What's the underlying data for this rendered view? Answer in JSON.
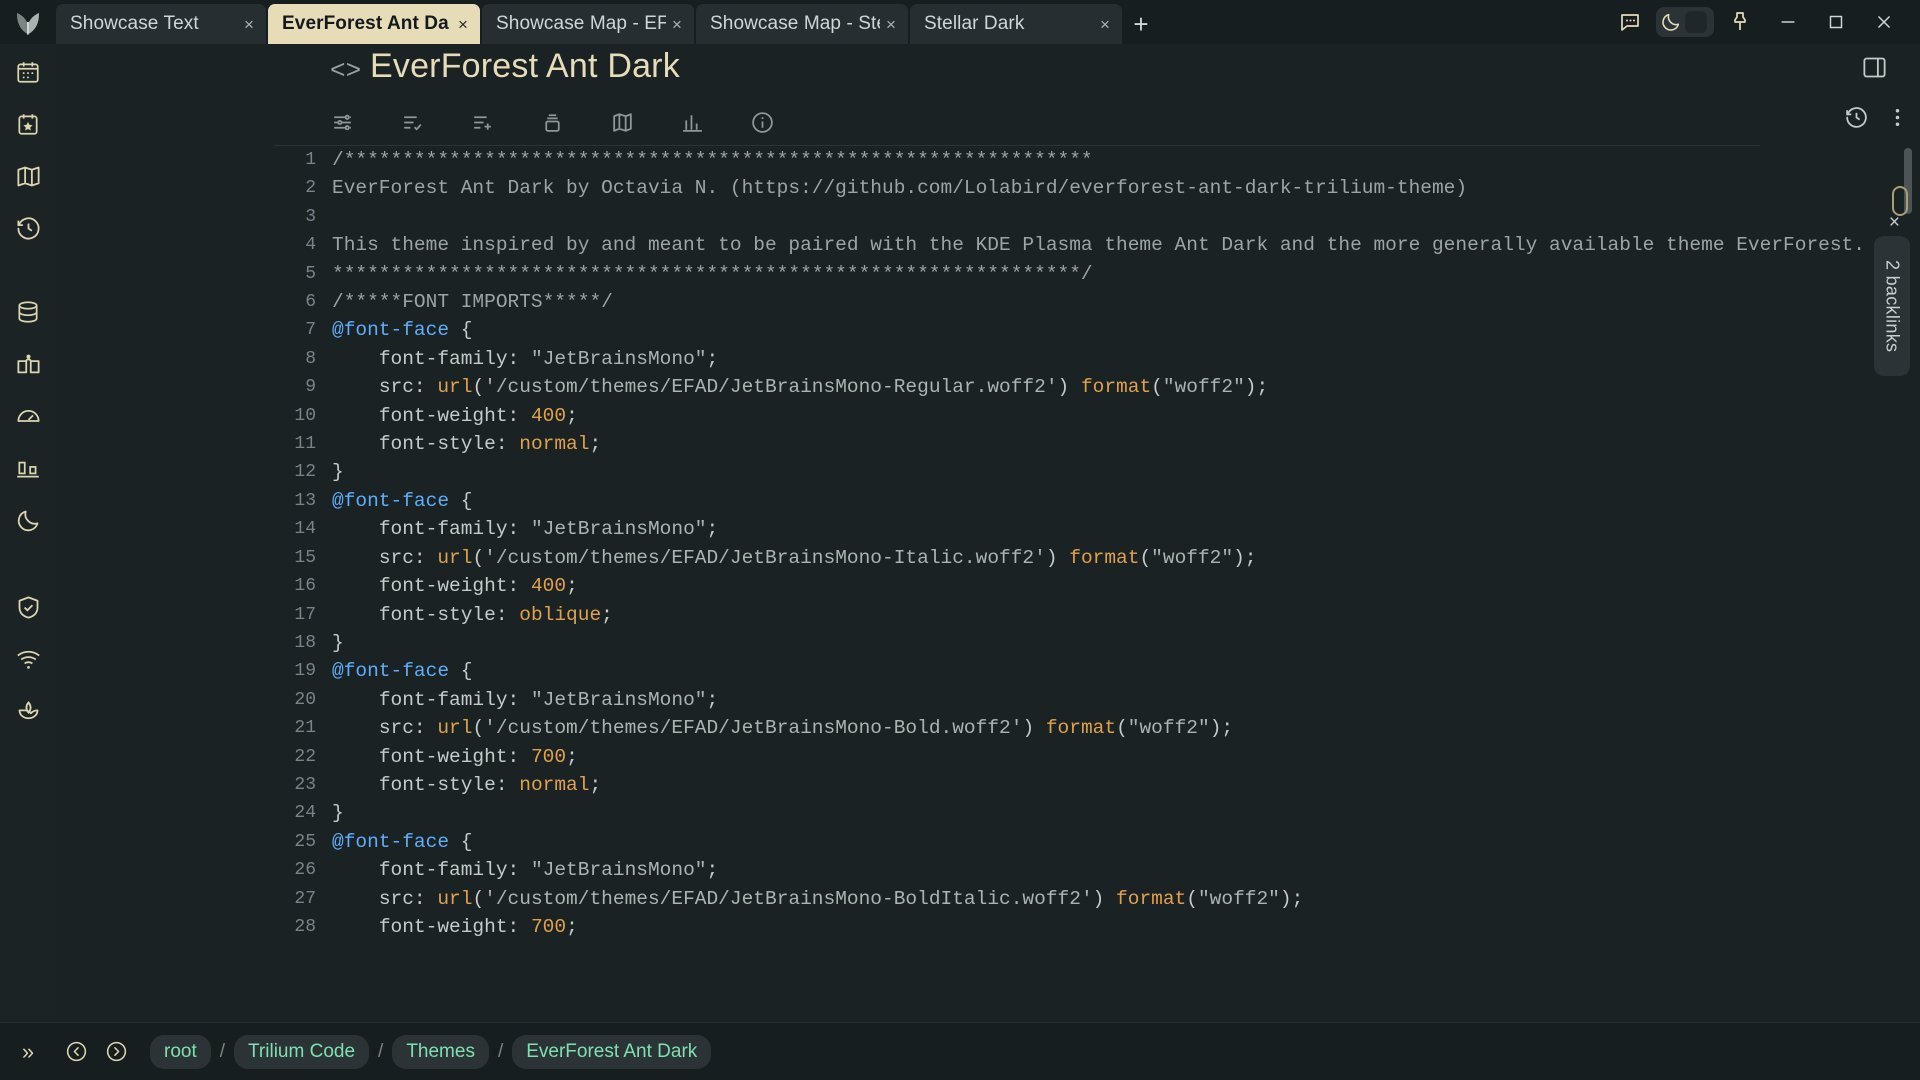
{
  "window": {
    "tabs": [
      {
        "title": "Showcase Text",
        "active": false
      },
      {
        "title": "EverForest Ant Da",
        "active": true
      },
      {
        "title": "Showcase Map - EF/",
        "active": false
      },
      {
        "title": "Showcase Map - Ste",
        "active": false
      },
      {
        "title": "Stellar Dark",
        "active": false
      }
    ],
    "new_tab_label": "+",
    "close_label": "×",
    "controls": {
      "chat_icon": "chat-bubble-icon",
      "theme_toggle_icon": "moon-icon",
      "pin_icon": "pin-icon",
      "minimize_label": "—",
      "maximize_label": "□",
      "close_label": "×"
    }
  },
  "sidebar": {
    "logo_icon": "trilium-leaf-logo",
    "items": [
      {
        "icon": "calendar-icon",
        "name": "sidebar-item-calendar"
      },
      {
        "icon": "calendar-star-icon",
        "name": "sidebar-item-favorites"
      },
      {
        "icon": "map-icon",
        "name": "sidebar-item-map"
      },
      {
        "icon": "history-clock-icon",
        "name": "sidebar-item-recent"
      },
      {
        "icon": "database-icon",
        "name": "sidebar-item-database"
      },
      {
        "icon": "open-book-icon",
        "name": "sidebar-item-notes"
      },
      {
        "icon": "gauge-icon",
        "name": "sidebar-item-dashboard"
      },
      {
        "icon": "bar-chart-icon",
        "name": "sidebar-item-stats"
      },
      {
        "icon": "moon-icon",
        "name": "sidebar-item-theme"
      },
      {
        "icon": "shield-check-icon",
        "name": "sidebar-item-security"
      },
      {
        "icon": "wifi-icon",
        "name": "sidebar-item-sync"
      },
      {
        "icon": "lotus-icon",
        "name": "sidebar-item-zen"
      }
    ],
    "expand_label": "»"
  },
  "note": {
    "type_icon": "code-brackets-icon",
    "title": "EverForest Ant Dark",
    "panel_toggle_icon": "right-panel-icon",
    "toolbar": [
      {
        "icon": "sliders-icon",
        "name": "tool-attributes"
      },
      {
        "icon": "list-check-icon",
        "name": "tool-tasks"
      },
      {
        "icon": "list-plus-icon",
        "name": "tool-add-list"
      },
      {
        "icon": "archive-box-icon",
        "name": "tool-archive"
      },
      {
        "icon": "book-map-icon",
        "name": "tool-book"
      },
      {
        "icon": "bar-chart-icon",
        "name": "tool-chart"
      },
      {
        "icon": "info-circle-icon",
        "name": "tool-info"
      }
    ],
    "toolbar_right": [
      {
        "icon": "history-revision-icon",
        "name": "tool-revisions"
      },
      {
        "icon": "more-vertical-icon",
        "name": "tool-more"
      }
    ]
  },
  "backlinks": {
    "label": "2 backlinks",
    "close_label": "×"
  },
  "breadcrumb": {
    "back_icon": "arrow-back-circle-icon",
    "forward_icon": "arrow-forward-circle-icon",
    "separator": "/",
    "items": [
      "root",
      "Trilium Code",
      "Themes",
      "EverForest Ant Dark"
    ]
  },
  "colors": {
    "accent": "#e6dcb8",
    "background": "#1b2224",
    "tabbar": "#171e20",
    "breadcrumb_text": "#7fe0b0",
    "comment": "#9aa6a3",
    "at_rule": "#5eaefb",
    "function": "#e0a14a",
    "string": "#a8b5b1"
  },
  "code": {
    "lines": [
      {
        "n": 1,
        "tokens": [
          {
            "t": "/****************************************************************",
            "c": "cmt"
          }
        ]
      },
      {
        "n": 2,
        "tokens": [
          {
            "t": "EverForest Ant Dark by Octavia N. (https://github.com/Lolabird/everforest-ant-dark-trilium-theme)",
            "c": "cmt"
          }
        ]
      },
      {
        "n": 3,
        "tokens": []
      },
      {
        "n": 4,
        "tokens": [
          {
            "t": "This theme inspired by and meant to be paired with the KDE Plasma theme Ant Dark and the more generally available theme EverForest.",
            "c": "cmt"
          }
        ]
      },
      {
        "n": 5,
        "tokens": [
          {
            "t": "****************************************************************/",
            "c": "cmt"
          }
        ]
      },
      {
        "n": 6,
        "tokens": [
          {
            "t": "/*****FONT IMPORTS*****/",
            "c": "cmt"
          }
        ]
      },
      {
        "n": 7,
        "tokens": [
          {
            "t": "@font-face",
            "c": "atr"
          },
          {
            "t": " {",
            "c": "punc"
          }
        ]
      },
      {
        "n": 8,
        "tokens": [
          {
            "t": "    font-family",
            "c": "prop"
          },
          {
            "t": ": ",
            "c": "punc"
          },
          {
            "t": "\"JetBrainsMono\"",
            "c": "str"
          },
          {
            "t": ";",
            "c": "punc"
          }
        ]
      },
      {
        "n": 9,
        "tokens": [
          {
            "t": "    src",
            "c": "prop"
          },
          {
            "t": ": ",
            "c": "punc"
          },
          {
            "t": "url",
            "c": "fn"
          },
          {
            "t": "(",
            "c": "punc"
          },
          {
            "t": "'/custom/themes/EFAD/JetBrainsMono-Regular.woff2'",
            "c": "str"
          },
          {
            "t": ") ",
            "c": "punc"
          },
          {
            "t": "format",
            "c": "fn"
          },
          {
            "t": "(",
            "c": "punc"
          },
          {
            "t": "\"woff2\"",
            "c": "str"
          },
          {
            "t": ");",
            "c": "punc"
          }
        ]
      },
      {
        "n": 10,
        "tokens": [
          {
            "t": "    font-weight",
            "c": "prop"
          },
          {
            "t": ": ",
            "c": "punc"
          },
          {
            "t": "400",
            "c": "num2"
          },
          {
            "t": ";",
            "c": "punc"
          }
        ]
      },
      {
        "n": 11,
        "tokens": [
          {
            "t": "    font-style",
            "c": "prop"
          },
          {
            "t": ": ",
            "c": "punc"
          },
          {
            "t": "normal",
            "c": "num2"
          },
          {
            "t": ";",
            "c": "punc"
          }
        ]
      },
      {
        "n": 12,
        "tokens": [
          {
            "t": "}",
            "c": "punc"
          }
        ]
      },
      {
        "n": 13,
        "tokens": [
          {
            "t": "@font-face",
            "c": "atr"
          },
          {
            "t": " {",
            "c": "punc"
          }
        ]
      },
      {
        "n": 14,
        "tokens": [
          {
            "t": "    font-family",
            "c": "prop"
          },
          {
            "t": ": ",
            "c": "punc"
          },
          {
            "t": "\"JetBrainsMono\"",
            "c": "str"
          },
          {
            "t": ";",
            "c": "punc"
          }
        ]
      },
      {
        "n": 15,
        "tokens": [
          {
            "t": "    src",
            "c": "prop"
          },
          {
            "t": ": ",
            "c": "punc"
          },
          {
            "t": "url",
            "c": "fn"
          },
          {
            "t": "(",
            "c": "punc"
          },
          {
            "t": "'/custom/themes/EFAD/JetBrainsMono-Italic.woff2'",
            "c": "str"
          },
          {
            "t": ") ",
            "c": "punc"
          },
          {
            "t": "format",
            "c": "fn"
          },
          {
            "t": "(",
            "c": "punc"
          },
          {
            "t": "\"woff2\"",
            "c": "str"
          },
          {
            "t": ");",
            "c": "punc"
          }
        ]
      },
      {
        "n": 16,
        "tokens": [
          {
            "t": "    font-weight",
            "c": "prop"
          },
          {
            "t": ": ",
            "c": "punc"
          },
          {
            "t": "400",
            "c": "num2"
          },
          {
            "t": ";",
            "c": "punc"
          }
        ]
      },
      {
        "n": 17,
        "tokens": [
          {
            "t": "    font-style",
            "c": "prop"
          },
          {
            "t": ": ",
            "c": "punc"
          },
          {
            "t": "oblique",
            "c": "num2"
          },
          {
            "t": ";",
            "c": "punc"
          }
        ]
      },
      {
        "n": 18,
        "tokens": [
          {
            "t": "}",
            "c": "punc"
          }
        ]
      },
      {
        "n": 19,
        "tokens": [
          {
            "t": "@font-face",
            "c": "atr"
          },
          {
            "t": " {",
            "c": "punc"
          }
        ]
      },
      {
        "n": 20,
        "tokens": [
          {
            "t": "    font-family",
            "c": "prop"
          },
          {
            "t": ": ",
            "c": "punc"
          },
          {
            "t": "\"JetBrainsMono\"",
            "c": "str"
          },
          {
            "t": ";",
            "c": "punc"
          }
        ]
      },
      {
        "n": 21,
        "tokens": [
          {
            "t": "    src",
            "c": "prop"
          },
          {
            "t": ": ",
            "c": "punc"
          },
          {
            "t": "url",
            "c": "fn"
          },
          {
            "t": "(",
            "c": "punc"
          },
          {
            "t": "'/custom/themes/EFAD/JetBrainsMono-Bold.woff2'",
            "c": "str"
          },
          {
            "t": ") ",
            "c": "punc"
          },
          {
            "t": "format",
            "c": "fn"
          },
          {
            "t": "(",
            "c": "punc"
          },
          {
            "t": "\"woff2\"",
            "c": "str"
          },
          {
            "t": ");",
            "c": "punc"
          }
        ]
      },
      {
        "n": 22,
        "tokens": [
          {
            "t": "    font-weight",
            "c": "prop"
          },
          {
            "t": ": ",
            "c": "punc"
          },
          {
            "t": "700",
            "c": "num2"
          },
          {
            "t": ";",
            "c": "punc"
          }
        ]
      },
      {
        "n": 23,
        "tokens": [
          {
            "t": "    font-style",
            "c": "prop"
          },
          {
            "t": ": ",
            "c": "punc"
          },
          {
            "t": "normal",
            "c": "num2"
          },
          {
            "t": ";",
            "c": "punc"
          }
        ]
      },
      {
        "n": 24,
        "tokens": [
          {
            "t": "}",
            "c": "punc"
          }
        ]
      },
      {
        "n": 25,
        "tokens": [
          {
            "t": "@font-face",
            "c": "atr"
          },
          {
            "t": " {",
            "c": "punc"
          }
        ]
      },
      {
        "n": 26,
        "tokens": [
          {
            "t": "    font-family",
            "c": "prop"
          },
          {
            "t": ": ",
            "c": "punc"
          },
          {
            "t": "\"JetBrainsMono\"",
            "c": "str"
          },
          {
            "t": ";",
            "c": "punc"
          }
        ]
      },
      {
        "n": 27,
        "tokens": [
          {
            "t": "    src",
            "c": "prop"
          },
          {
            "t": ": ",
            "c": "punc"
          },
          {
            "t": "url",
            "c": "fn"
          },
          {
            "t": "(",
            "c": "punc"
          },
          {
            "t": "'/custom/themes/EFAD/JetBrainsMono-BoldItalic.woff2'",
            "c": "str"
          },
          {
            "t": ") ",
            "c": "punc"
          },
          {
            "t": "format",
            "c": "fn"
          },
          {
            "t": "(",
            "c": "punc"
          },
          {
            "t": "\"woff2\"",
            "c": "str"
          },
          {
            "t": ");",
            "c": "punc"
          }
        ]
      },
      {
        "n": 28,
        "tokens": [
          {
            "t": "    font-weight",
            "c": "prop"
          },
          {
            "t": ": ",
            "c": "punc"
          },
          {
            "t": "700",
            "c": "num2"
          },
          {
            "t": ";",
            "c": "punc"
          }
        ]
      }
    ]
  }
}
